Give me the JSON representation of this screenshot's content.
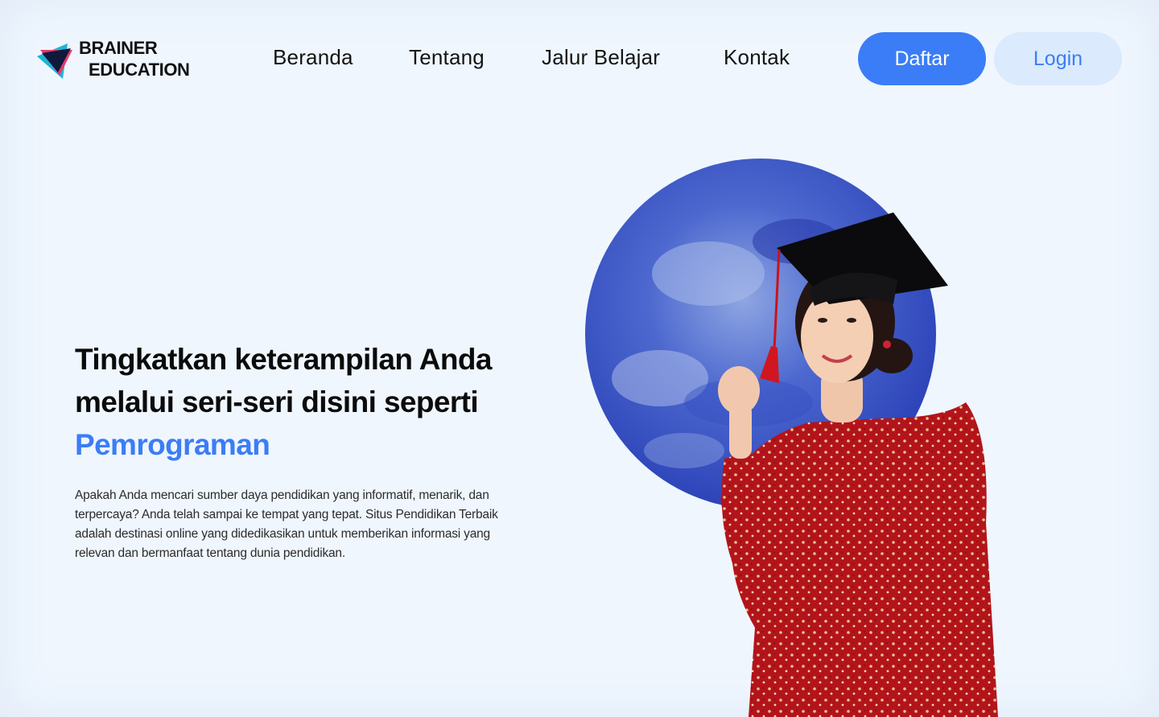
{
  "brand": {
    "line1": "BRAINER",
    "line2": "EDUCATION",
    "colors": {
      "pink": "#e8386b",
      "cyan": "#1fb3d8",
      "navy": "#0d1a3c"
    }
  },
  "nav": {
    "items": [
      {
        "label": "Beranda"
      },
      {
        "label": "Tentang"
      },
      {
        "label": "Jalur Belajar"
      },
      {
        "label": "Kontak"
      }
    ]
  },
  "auth": {
    "register_label": "Daftar",
    "login_label": "Login"
  },
  "hero": {
    "headline_line1": "Tingkatkan keterampilan Anda",
    "headline_line2": "melalui seri-seri disini seperti",
    "headline_accent": "Pemrograman",
    "description": "Apakah Anda mencari sumber daya pendidikan yang informatif, menarik, dan terpercaya? Anda telah sampai ke tempat yang tepat. Situs Pendidikan Terbaik adalah destinasi online yang didedikasikan untuk memberikan informasi yang relevan dan bermanfaat tentang dunia pendidikan.",
    "image": "graduate-woman-in-red-kebaya-with-cap-on-blue-watercolor-circle"
  },
  "theme": {
    "accent": "#3b7df6",
    "accent_light": "#dbeafd",
    "background": "#eff6fe"
  }
}
